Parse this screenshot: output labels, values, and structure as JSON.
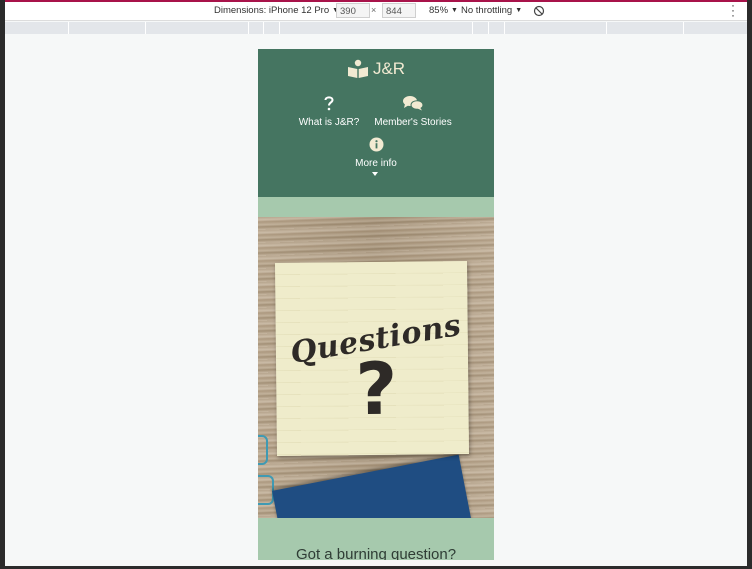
{
  "toolbar": {
    "dimensions_label": "Dimensions: iPhone 12 Pro",
    "width": "390",
    "height": "844",
    "times": "×",
    "zoom": "85%",
    "throttling": "No throttling",
    "rotate_icon": "rotate-icon",
    "more_icon": "kebab-menu-icon"
  },
  "site": {
    "logo_text": "J&R",
    "logo_icon": "open-book-reader-icon",
    "accent": "#457561",
    "band": "#a6c9ad",
    "nav": [
      {
        "label": "What is J&R?",
        "icon": "question-mark-icon"
      },
      {
        "label": "Member's Stories",
        "icon": "speech-bubbles-icon"
      },
      {
        "label": "More info",
        "icon": "info-circle-icon"
      }
    ],
    "hero_note_text": "Questions",
    "hero_note_mark": "?",
    "section_heading": "Got a burning question?"
  }
}
